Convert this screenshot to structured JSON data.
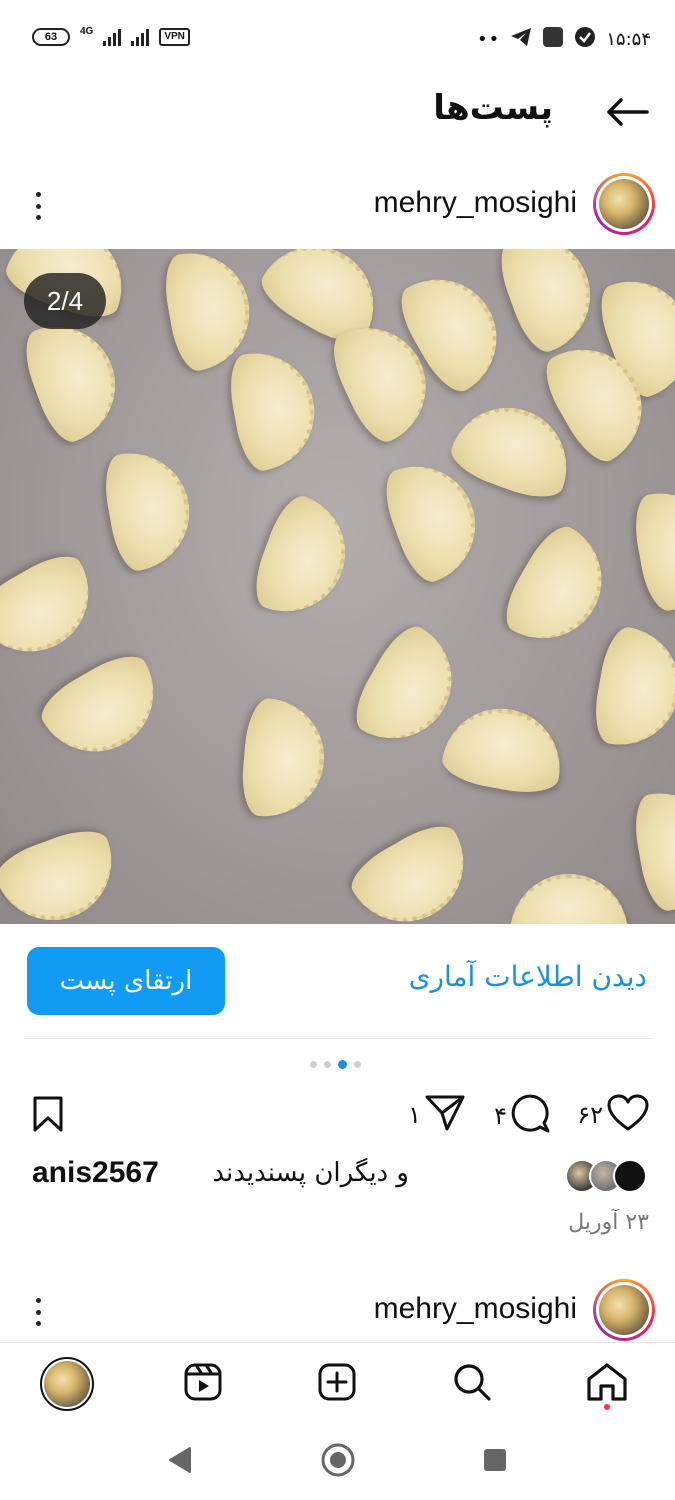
{
  "status_bar": {
    "battery": "63",
    "network": "4G",
    "vpn": "VPN",
    "more_indicator": "••",
    "time": "۱۵:۵۴",
    "icons": [
      "telegram-icon",
      "app-square-icon",
      "shield-icon"
    ]
  },
  "header": {
    "title": "پست‌ها",
    "back_icon": "arrow-back-icon"
  },
  "post": {
    "author": "mehry_mosighi",
    "image_counter": "2/4",
    "boost_label": "ارتقای پست",
    "insights_label": "دیدن اطلاعات آماری",
    "carousel": {
      "total": 4,
      "active_index": 2
    },
    "likes_count": "۶۲",
    "comments_count": "۴",
    "shares_count": "۱",
    "liked_by_user": "anis2567",
    "liked_by_suffix": "و دیگران پسندیدند",
    "date": "۲۳ آوریل"
  },
  "next_post": {
    "author": "mehry_mosighi"
  },
  "bottom_nav": {
    "items": [
      "profile-avatar",
      "reels-icon",
      "create-icon",
      "search-icon",
      "home-icon"
    ],
    "active": "home-icon"
  },
  "colors": {
    "accent_blue": "#119bf5",
    "link_blue": "#1d8fe0",
    "notification_red": "#ff3040"
  }
}
